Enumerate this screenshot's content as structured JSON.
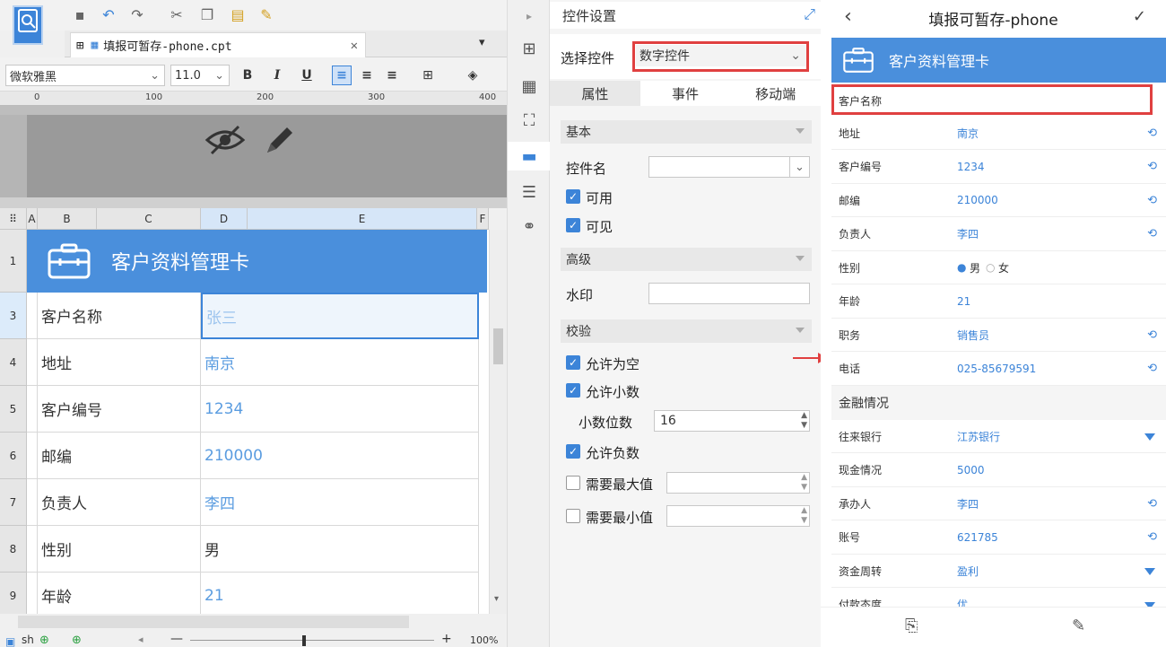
{
  "designer": {
    "file_tab": "填报可暂存-phone.cpt",
    "font_name": "微软雅黑",
    "font_size": "11.0",
    "bold": "B",
    "italic": "I",
    "underline": "U",
    "ruler_marks": [
      "0",
      "100",
      "200",
      "300",
      "400"
    ],
    "columns": [
      "A",
      "B",
      "C",
      "D",
      "E",
      "F"
    ],
    "title_row": {
      "row": "1",
      "text": "客户资料管理卡"
    },
    "rows": [
      {
        "row": "3",
        "label": "客户名称",
        "value": "张三"
      },
      {
        "row": "4",
        "label": "地址",
        "value": "南京"
      },
      {
        "row": "5",
        "label": "客户编号",
        "value": "1234"
      },
      {
        "row": "6",
        "label": "邮编",
        "value": "210000"
      },
      {
        "row": "7",
        "label": "负责人",
        "value": "李四"
      },
      {
        "row": "8",
        "label": "性别",
        "value": "男"
      },
      {
        "row": "9",
        "label": "年龄",
        "value": "21"
      }
    ],
    "sheet_tab": "sh",
    "zoom": "100%"
  },
  "panel": {
    "title": "控件设置",
    "select_label": "选择控件",
    "select_value": "数字控件",
    "tabs": [
      "属性",
      "事件",
      "移动端"
    ],
    "section_basic": "基本",
    "widget_name_label": "控件名",
    "enabled_label": "可用",
    "visible_label": "可见",
    "section_advanced": "高级",
    "watermark_label": "水印",
    "section_validate": "校验",
    "allow_empty_label": "允许为空",
    "allow_decimal_label": "允许小数",
    "decimal_places_label": "小数位数",
    "decimal_places_value": "16",
    "allow_negative_label": "允许负数",
    "need_max_label": "需要最大值",
    "need_min_label": "需要最小值"
  },
  "phone": {
    "title": "填报可暂存-phone",
    "card_title": "客户资料管理卡",
    "first_field": "客户名称",
    "rows": [
      {
        "label": "地址",
        "value": "南京",
        "icon": "edit"
      },
      {
        "label": "客户编号",
        "value": "1234",
        "icon": "edit"
      },
      {
        "label": "邮编",
        "value": "210000",
        "icon": "edit"
      },
      {
        "label": "负责人",
        "value": "李四",
        "icon": "edit"
      },
      {
        "label": "性别",
        "value": "",
        "icon": ""
      },
      {
        "label": "年龄",
        "value": "21",
        "icon": ""
      },
      {
        "label": "职务",
        "value": "销售员",
        "icon": "edit"
      },
      {
        "label": "电话",
        "value": "025-85679591",
        "icon": "edit"
      }
    ],
    "gender_male": "男",
    "gender_female": "女",
    "section2": "金融情况",
    "rows2": [
      {
        "label": "往来银行",
        "value": "江苏银行",
        "icon": "dropdown"
      },
      {
        "label": "现金情况",
        "value": "5000",
        "icon": ""
      },
      {
        "label": "承办人",
        "value": "李四",
        "icon": "edit"
      },
      {
        "label": "账号",
        "value": "621785",
        "icon": "edit"
      },
      {
        "label": "资金周转",
        "value": "盈利",
        "icon": "dropdown"
      },
      {
        "label": "付款态度",
        "value": "优",
        "icon": "dropdown"
      }
    ]
  },
  "colors": {
    "accent": "#3c84d8",
    "highlight": "#e04040"
  }
}
